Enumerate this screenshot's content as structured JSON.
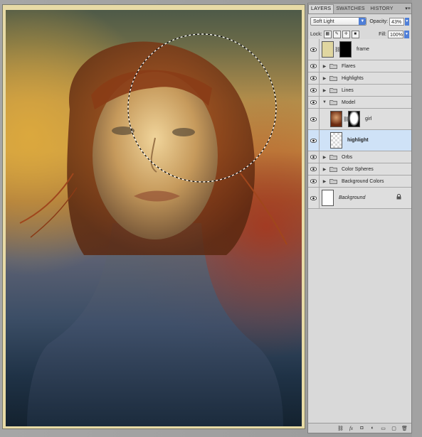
{
  "panel": {
    "tabs": [
      {
        "label": "LAYERS",
        "active": true
      },
      {
        "label": "SWATCHES",
        "active": false
      },
      {
        "label": "HISTORY",
        "active": false
      }
    ],
    "menu_glyph": "▾≡",
    "blend_mode": "Soft Light",
    "opacity_label": "Opacity:",
    "opacity_value": "43%",
    "lock_label": "Lock:",
    "fill_label": "Fill:",
    "fill_value": "100%"
  },
  "layers": [
    {
      "name": "frame",
      "type": "adjustment",
      "visible": true,
      "thumb_color": "#e0d6a0",
      "mask": "black"
    },
    {
      "name": "Flares",
      "type": "group",
      "visible": true,
      "expanded": false
    },
    {
      "name": "Highlights",
      "type": "group",
      "visible": true,
      "expanded": false
    },
    {
      "name": "Lines",
      "type": "group",
      "visible": true,
      "expanded": false
    },
    {
      "name": "Model",
      "type": "group",
      "visible": true,
      "expanded": true
    },
    {
      "name": "girl",
      "type": "masked-layer",
      "visible": true
    },
    {
      "name": "highlight",
      "type": "layer",
      "visible": true,
      "selected": true
    },
    {
      "name": "Orbs",
      "type": "group",
      "visible": true,
      "expanded": false
    },
    {
      "name": "Color Spheres",
      "type": "group",
      "visible": true,
      "expanded": false
    },
    {
      "name": "Background Colors",
      "type": "group",
      "visible": true,
      "expanded": false
    },
    {
      "name": "Background",
      "type": "background",
      "visible": true,
      "locked": true
    }
  ],
  "bottom_icons": [
    "link-layers-icon",
    "fx-icon",
    "add-mask-icon",
    "adjustment-layer-icon",
    "new-group-icon",
    "new-layer-icon",
    "trash-icon"
  ],
  "colors": {
    "selected_row": "#cfe2f7",
    "panel_bg": "#d9d9d9",
    "frame_border": "#e8dba6",
    "accent_blue": "#4f7fd8"
  }
}
